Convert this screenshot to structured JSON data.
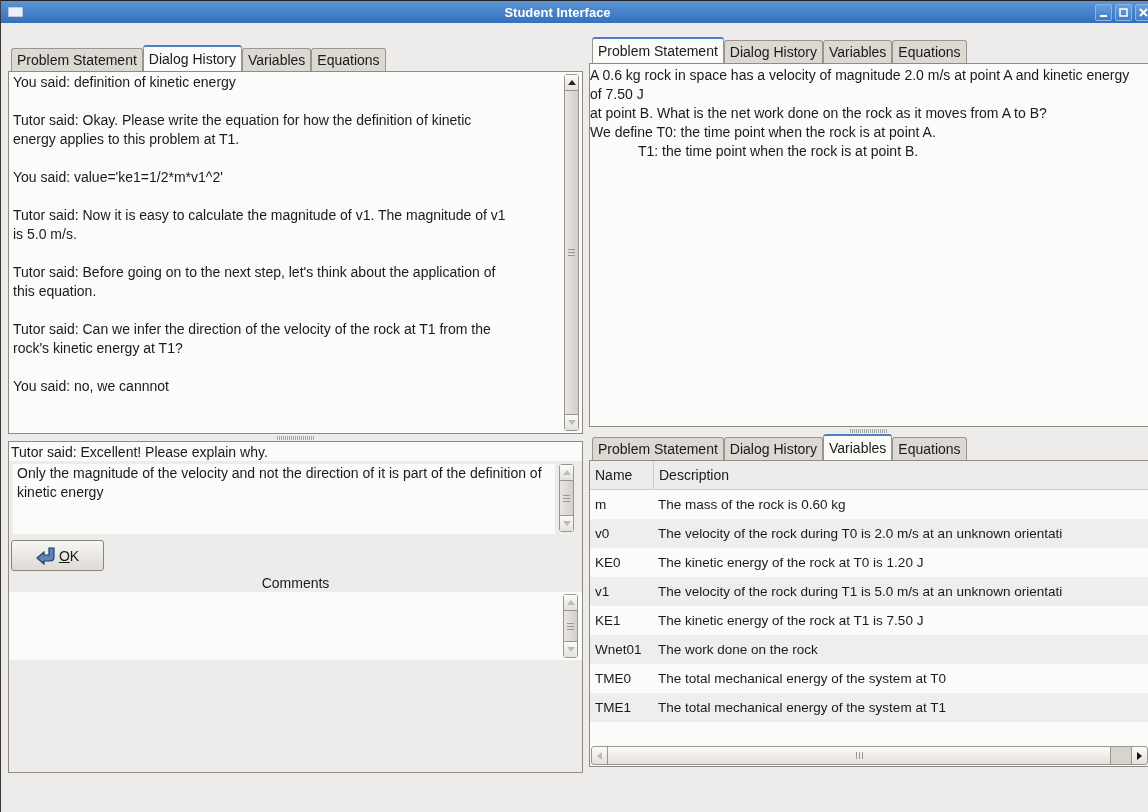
{
  "window": {
    "title": "Student Interface"
  },
  "left_panel": {
    "tabs": [
      {
        "label": "Problem Statement",
        "selected": false
      },
      {
        "label": "Dialog History",
        "selected": true
      },
      {
        "label": "Variables",
        "selected": false
      },
      {
        "label": "Equations",
        "selected": false
      }
    ],
    "dialog_history": [
      "You said: definition of kinetic energy",
      "Tutor said: Okay. Please write the equation for how the definition of kinetic energy applies to this problem at T1.",
      "You said: value='ke1=1/2*m*v1^2'",
      "Tutor said:  Now it is easy to calculate the magnitude of v1. The magnitude of v1 is 5.0 m/s.",
      "Tutor said:  Before going on to the next step, let's think about the application of this equation.",
      "Tutor said:  Can we infer the direction of the velocity of the rock at T1 from the rock's kinetic energy at T1?",
      "You said: no, we cannnot"
    ],
    "tutor_prompt": "Tutor said: Excellent! Please explain why.",
    "answer": {
      "value": "Only the magnitude of the velocity and not the direction of it is part of the definition of kinetic energy"
    },
    "ok_button": "OK",
    "comments": {
      "label": "Comments"
    }
  },
  "top_right_panel": {
    "tabs": [
      {
        "label": "Problem Statement",
        "selected": true
      },
      {
        "label": "Dialog History",
        "selected": false
      },
      {
        "label": "Variables",
        "selected": false
      },
      {
        "label": "Equations",
        "selected": false
      }
    ],
    "problem_statement": [
      {
        "text": "A 0.6 kg rock in space has a velocity of magnitude 2.0 m/s at point A and kinetic energy of 7.50 J",
        "indent": false
      },
      {
        "text": "at point B. What is the net work done on the rock as it moves from A to B?",
        "indent": false
      },
      {
        "text": "We define T0: the time point when the rock is at point A.",
        "indent": false
      },
      {
        "text": "T1: the time point when the rock is at point B.",
        "indent": true
      }
    ]
  },
  "bottom_right_panel": {
    "tabs": [
      {
        "label": "Problem Statement",
        "selected": false
      },
      {
        "label": "Dialog History",
        "selected": false
      },
      {
        "label": "Variables",
        "selected": true
      },
      {
        "label": "Equations",
        "selected": false
      }
    ],
    "table": {
      "columns": [
        "Name",
        "Description"
      ],
      "rows": [
        [
          "m",
          "The mass of the rock is 0.60 kg"
        ],
        [
          "v0",
          "The velocity of the rock during T0 is 2.0 m/s at an unknown orientati"
        ],
        [
          "KE0",
          "The kinetic energy of the rock at T0 is 1.20 J"
        ],
        [
          "v1",
          "The velocity of the rock during T1 is 5.0 m/s at an unknown orientati"
        ],
        [
          "KE1",
          "The kinetic energy of the rock at T1 is 7.50 J"
        ],
        [
          "Wnet01",
          "The work done on the rock"
        ],
        [
          "TME0",
          "The total mechanical energy of the system at T0"
        ],
        [
          "TME1",
          "The total mechanical energy of the system at T1"
        ]
      ]
    }
  }
}
